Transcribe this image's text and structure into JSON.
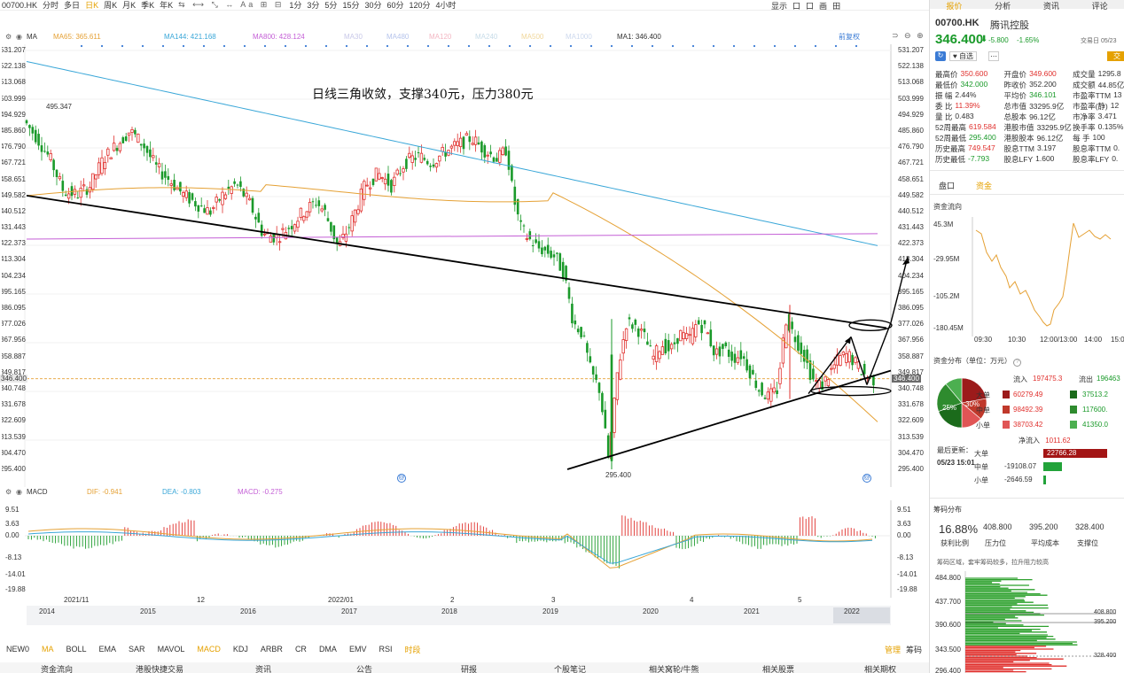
{
  "toolbar": {
    "code": "00700.HK",
    "periods": [
      "分时",
      "多日",
      "日K",
      "周K",
      "月K",
      "季K",
      "年K",
      "1分",
      "3分",
      "5分",
      "15分",
      "30分",
      "60分",
      "120分",
      "4小时"
    ],
    "active_period": "日K",
    "right": [
      "显示",
      "口",
      "口",
      "画",
      "田"
    ]
  },
  "ma_bar": {
    "type": "MA",
    "ma65": "MA65: 365.611",
    "ma144": "MA144: 421.168",
    "ma800": "MA800: 428.124",
    "ma30": "MA30",
    "ma480": "MA480",
    "ma120": "MA120",
    "ma240": "MA240",
    "ma500": "MA500",
    "ma1000": "MA1000",
    "ma1": "MA1: 346.400",
    "adjust": "前复权"
  },
  "annotation": "日线三角收敛，支撑340元，压力380元",
  "price_labels": {
    "high": "495.347",
    "low": "295.400",
    "current": "346.400"
  },
  "price_axis": [
    "531.207",
    "522.138",
    "513.068",
    "503.999",
    "494.929",
    "485.860",
    "476.790",
    "467.721",
    "458.651",
    "449.582",
    "440.512",
    "431.443",
    "422.373",
    "413.304",
    "404.234",
    "395.165",
    "386.095",
    "377.026",
    "367.956",
    "358.887",
    "349.817",
    "340.748",
    "331.678",
    "322.609",
    "313.539",
    "304.470",
    "295.400"
  ],
  "price_axis_left": [
    "531.207",
    "522.138",
    "513.068",
    "503.999",
    "494.929",
    "485.860",
    "476.790",
    "467.721",
    "458.651",
    "449.582",
    "440.512",
    "431.443",
    "422.373",
    "413.304",
    "404.234",
    "395.165",
    "386.095",
    "377.026",
    "367.956",
    "358.887",
    "349.817",
    "340.748",
    "331.678",
    "322.609",
    "313.539",
    "304.470",
    "295.400"
  ],
  "macd_bar": {
    "name": "MACD",
    "dif": "DIF: -0.941",
    "dea": "DEA: -0.803",
    "macd": "MACD: -0.275"
  },
  "macd_axis": [
    "9.51",
    "3.63",
    "0.00",
    "-8.13",
    "-14.01",
    "-19.88"
  ],
  "date_axis": [
    "2021/11",
    "12",
    "2022/01",
    "2",
    "3",
    "4",
    "5"
  ],
  "year_axis": [
    "2014",
    "2015",
    "2016",
    "2017",
    "2018",
    "2019",
    "2020",
    "2021",
    "2022"
  ],
  "bottom_tabs": [
    "NEW0",
    "MA",
    "BOLL",
    "EMA",
    "SAR",
    "MAVOL",
    "MACD",
    "KDJ",
    "ARBR",
    "CR",
    "DMA",
    "EMV",
    "RSI",
    "时段"
  ],
  "bottom_tabs_active": [
    "MA",
    "MACD",
    "时段"
  ],
  "bottom_right": [
    "管理",
    "筹码"
  ],
  "bottom_links": [
    "资金流向",
    "港股快捷交易",
    "资讯",
    "公告",
    "研报",
    "个股笔记",
    "相关窝轮/牛熊",
    "相关股票",
    "相关期权"
  ],
  "right_panel": {
    "tabs": [
      "报价",
      "分析",
      "资讯",
      "评论"
    ],
    "code": "00700.HK",
    "name": "腾讯控股",
    "price": "346.400",
    "change": "-5.800",
    "change_pct": "-1.65%",
    "trade_date": "交易日 05/23",
    "watch": "自选",
    "trade": "交",
    "stats": [
      [
        [
          "最高价",
          "350.600",
          "red"
        ],
        [
          "开盘价",
          "349.600",
          "red"
        ],
        [
          "成交量",
          "1295.8",
          ""
        ]
      ],
      [
        [
          "最低价",
          "342.000",
          "green"
        ],
        [
          "昨收价",
          "352.200",
          ""
        ],
        [
          "成交额",
          "44.85亿",
          ""
        ]
      ],
      [
        [
          "振   幅",
          "2.44%",
          ""
        ],
        [
          "平均价",
          "346.101",
          "green"
        ],
        [
          "市盈率TTM",
          "13",
          ""
        ]
      ],
      [
        [
          "委   比",
          "11.39%",
          "red"
        ],
        [
          "总市值",
          "33295.9亿",
          ""
        ],
        [
          "市盈率(静)",
          "12",
          ""
        ]
      ],
      [
        [
          "量   比",
          "0.483",
          ""
        ],
        [
          "总股本",
          "96.12亿",
          ""
        ],
        [
          "市净率",
          "3.471",
          ""
        ]
      ],
      [
        [
          "52周最高",
          "619.584",
          "red"
        ],
        [
          "港股市值",
          "33295.9亿",
          ""
        ],
        [
          "换手率",
          "0.135%",
          ""
        ]
      ],
      [
        [
          "52周最低",
          "295.400",
          "green"
        ],
        [
          "港股股本",
          "96.12亿",
          ""
        ],
        [
          "每   手",
          "100",
          ""
        ]
      ],
      [
        [
          "历史最高",
          "749.547",
          "red"
        ],
        [
          "股息TTM",
          "3.197",
          ""
        ],
        [
          "股息率TTM",
          "0.",
          ""
        ]
      ],
      [
        [
          "历史最低",
          "-7.793",
          "green"
        ],
        [
          "股息LFY",
          "1.600",
          ""
        ],
        [
          "股息率LFY",
          "0.",
          ""
        ]
      ]
    ],
    "sub_tabs": [
      "盘口",
      "资金"
    ],
    "sub_tab_active": "资金",
    "flow_title": "资金流向",
    "flow_axis": [
      "45.3M",
      "-29.95M",
      "-105.2M",
      "-180.45M"
    ],
    "flow_times": [
      "09:30",
      "10:30",
      "12:00/13:00",
      "14:00",
      "15:00"
    ],
    "dist_title": "资金分布（单位：万元）",
    "inflow_label": "流入",
    "inflow_total": "197475.3",
    "outflow_label": "流出",
    "outflow_total": "196463",
    "dist_rows": [
      {
        "label": "大单",
        "in": "60279.49",
        "out": "37513.2"
      },
      {
        "label": "中单",
        "in": "98492.39",
        "out": "117600."
      },
      {
        "label": "小单",
        "in": "38703.42",
        "out": "41350.0"
      }
    ],
    "pie_labels": [
      "25%",
      "30%"
    ],
    "net_title": "净流入",
    "net_total": "1011.62",
    "last_update_label": "最后更新：",
    "last_update": "05/23 15:01",
    "net_rows": [
      {
        "label": "大单",
        "value": "22766.28",
        "sign": "pos",
        "frac": 1.0
      },
      {
        "label": "中单",
        "value": "-19108.07",
        "sign": "neg",
        "frac": 0.84
      },
      {
        "label": "小单",
        "value": "-2646.59",
        "sign": "neg",
        "frac": 0.12
      }
    ],
    "chip_title": "筹码分布",
    "chip_stats": [
      {
        "value": "16.88%",
        "label": "获利比例"
      },
      {
        "value": "408.800",
        "label": "压力位"
      },
      {
        "value": "395.200",
        "label": "平均成本"
      },
      {
        "value": "328.400",
        "label": "支撑位"
      }
    ],
    "chip_note": "筹码区域，套牢筹码较多，拉升阻力较高",
    "chip_axis": [
      "484.800",
      "437.700",
      "390.600",
      "343.500",
      "296.400"
    ],
    "chip_marks": [
      "408.800",
      "395.200",
      "328.400"
    ]
  },
  "colors": {
    "up": "#e0302d",
    "down": "#1a9a2a",
    "ma65": "#e5a135",
    "ma144": "#3aa7d8",
    "ma800": "#c45fd6",
    "accent": "#e5a100"
  }
}
